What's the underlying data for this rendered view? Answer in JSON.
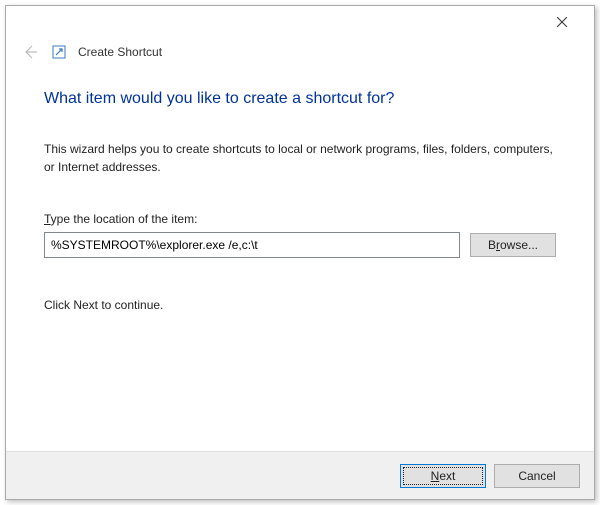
{
  "titlebar": {
    "close_label": "Close"
  },
  "header": {
    "back_label": "Back",
    "icon_name": "shortcut",
    "title": "Create Shortcut"
  },
  "main": {
    "instruction": "What item would you like to create a shortcut for?",
    "description": "This wizard helps you to create shortcuts to local or network programs, files, folders, computers, or Internet addresses.",
    "field_label_prefix": "T",
    "field_label_rest": "ype the location of the item:",
    "location_value": "%SYSTEMROOT%\\explorer.exe /e,c:\\t",
    "browse_prefix": "B",
    "browse_rest": "rowse...",
    "continue_text": "Click Next to continue."
  },
  "footer": {
    "next_prefix": "N",
    "next_rest": "ext",
    "cancel_label": "Cancel"
  }
}
